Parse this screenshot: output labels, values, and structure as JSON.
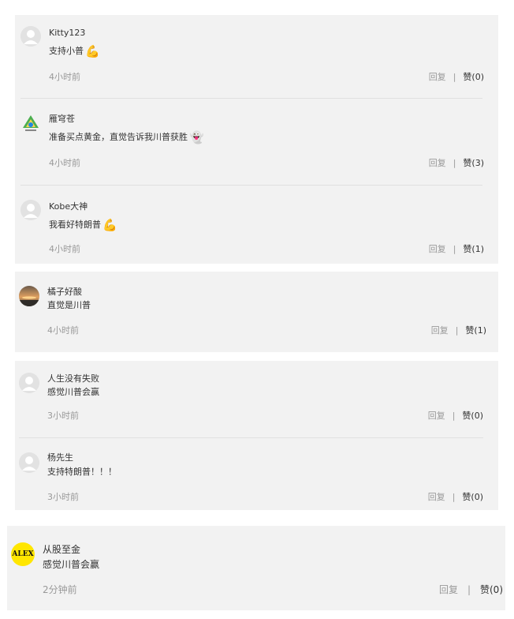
{
  "comments": [
    {
      "user": "Kitty123",
      "text": "支持小普",
      "emoji": "💪",
      "emoji_icon": "flexed-biceps-icon",
      "time": "4小时前",
      "reply": "回复",
      "sep": "|",
      "like": "赞(0)"
    },
    {
      "user": "雁穹苍",
      "text": "准备买点黄金，直觉告诉我川普获胜",
      "emoji": "👻",
      "emoji_icon": "ghost-icon",
      "time": "4小时前",
      "reply": "回复",
      "sep": "|",
      "like": "赞(3)"
    },
    {
      "user": "Kobe大神",
      "text": "我看好特朗普",
      "emoji": "💪",
      "emoji_icon": "flexed-biceps-icon",
      "time": "4小时前",
      "reply": "回复",
      "sep": "|",
      "like": "赞(1)"
    },
    {
      "user": "橘子好酸",
      "text": "直觉是川普",
      "time": "4小时前",
      "reply": "回复",
      "sep": "|",
      "like": "赞(1)"
    },
    {
      "user": "人生没有失败",
      "text": "感觉川普会赢",
      "time": "3小时前",
      "reply": "回复",
      "sep": "|",
      "like": "赞(0)"
    },
    {
      "user": "杨先生",
      "text": "支持特朗普！！！",
      "time": "3小时前",
      "reply": "回复",
      "sep": "|",
      "like": "赞(0)"
    },
    {
      "user": "从股至金",
      "text": "感觉川普会赢",
      "time": "2分钟前",
      "reply": "回复",
      "sep": "|",
      "like": "赞(0)",
      "avatar_text": "ALEX"
    }
  ],
  "colors": {
    "card_bg": "#f2f2f2",
    "text": "#333333",
    "muted": "#999999",
    "alex_avatar_bg": "#ffe600"
  }
}
